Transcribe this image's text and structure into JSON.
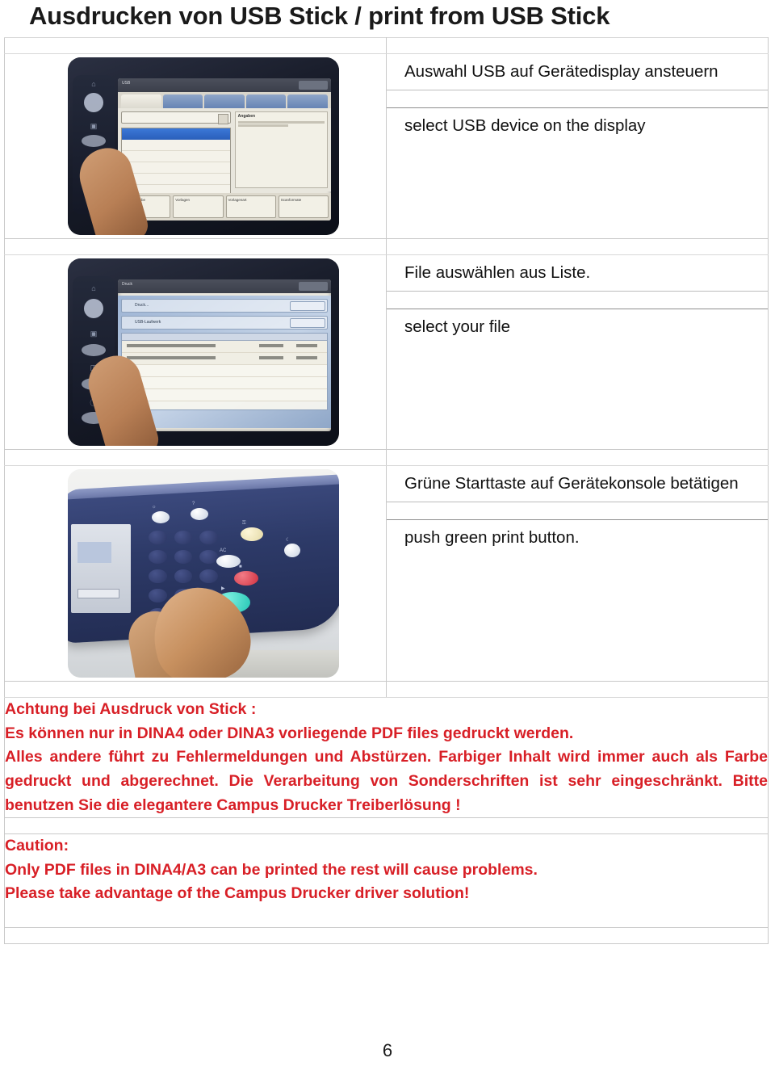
{
  "document": {
    "title": "Ausdrucken von USB Stick / print  from USB Stick",
    "page_number": "6"
  },
  "steps": [
    {
      "photo_name": "xerox-touchscreen-usb-selection-photo",
      "photo_alt": "Finger pressing USB entry on Xerox device touchscreen",
      "german": "Auswahl USB auf Gerätedisplay ansteuern",
      "english": "select USB device on the display"
    },
    {
      "photo_name": "xerox-touchscreen-file-list-photo",
      "photo_alt": "Finger selecting a PDF file from the list on the device touchscreen",
      "german": "File auswählen aus Liste.",
      "english": "select your file"
    },
    {
      "photo_name": "printer-console-green-start-button-photo",
      "photo_alt": "Finger pressing the green start button on the printer console keypad",
      "german": "Grüne Starttaste auf Gerätekonsole betätigen",
      "english": "push green print button."
    }
  ],
  "warning_de": {
    "heading": "Achtung bei Ausdruck von Stick :",
    "line1": "Es können nur in DINA4 oder DINA3 vorliegende PDF files gedruckt werden.",
    "line2": "Alles andere führt zu Fehlermeldungen und Abstürzen.  Farbiger Inhalt wird immer auch als Farbe gedruckt und abgerechnet.  Die  Verarbeitung von Sonderschriften ist sehr eingeschränkt. Bitte benutzen Sie die elegantere Campus Drucker Treiberlösung !"
  },
  "warning_en": {
    "heading": "Caution:",
    "line1": "Only PDF files in DINA4/A3 can be printed the rest will cause problems.",
    "line2": "Please take advantage of the Campus Drucker driver solution!"
  },
  "colors": {
    "warning_red": "#D81F26",
    "table_border": "#c9c9c9",
    "text_black": "#111111"
  }
}
